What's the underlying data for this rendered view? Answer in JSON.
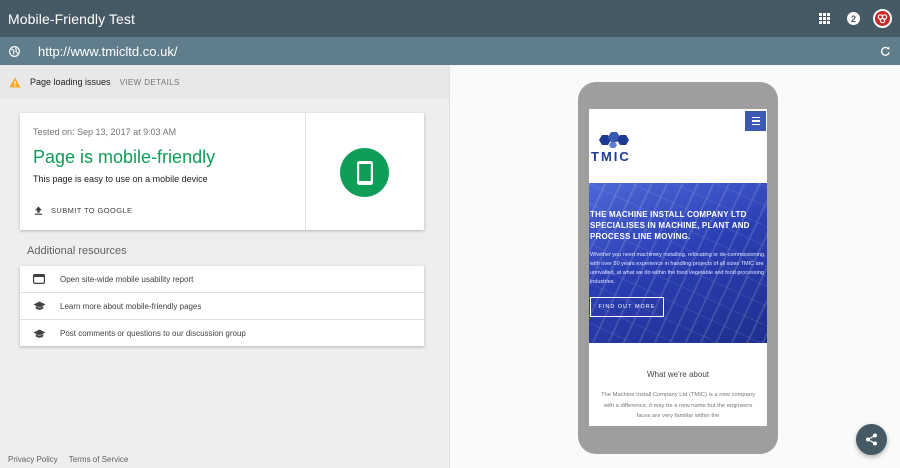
{
  "app": {
    "title": "Mobile-Friendly Test",
    "notification_count": "2"
  },
  "urlbar": {
    "url": "http://www.tmicltd.co.uk/"
  },
  "issues": {
    "label": "Page loading issues",
    "view_details": "VIEW DETAILS"
  },
  "result": {
    "tested_on": "Tested on: Sep 13, 2017 at 9:03 AM",
    "headline": "Page is mobile-friendly",
    "subtext": "This page is easy to use on a mobile device",
    "submit_label": "SUBMIT TO GOOGLE"
  },
  "resources": {
    "title": "Additional resources",
    "items": [
      {
        "label": "Open site-wide mobile usability report",
        "icon": "report-icon"
      },
      {
        "label": "Learn more about mobile-friendly pages",
        "icon": "school-icon"
      },
      {
        "label": "Post comments or questions to our discussion group",
        "icon": "school-icon"
      }
    ]
  },
  "footer": {
    "privacy": "Privacy Policy",
    "terms": "Terms of Service"
  },
  "preview": {
    "logo_text": "TMIC",
    "hero_heading": "THE MACHINE INSTALL COMPANY LTD SPECIALISES IN MACHINE, PLANT AND PROCESS LINE MOVING.",
    "hero_text": "Whether you need machinery installing, relocating or de-commissioning, with over 50 years experience in handling projects of all sizes TMIC are unrivalled, at what we do within the food vegetable and food processing industries.",
    "button": "FIND OUT MORE",
    "about_heading": "What we're about",
    "about_text": "The Machine Install Company Ltd (TMIC) is a new company with a difference, it may be a new name but the engineers faces are very familiar within the"
  },
  "colors": {
    "appbar": "#455a64",
    "urlbar": "#607d8b",
    "success": "#0f9d58",
    "brand": "#3a59b2"
  }
}
